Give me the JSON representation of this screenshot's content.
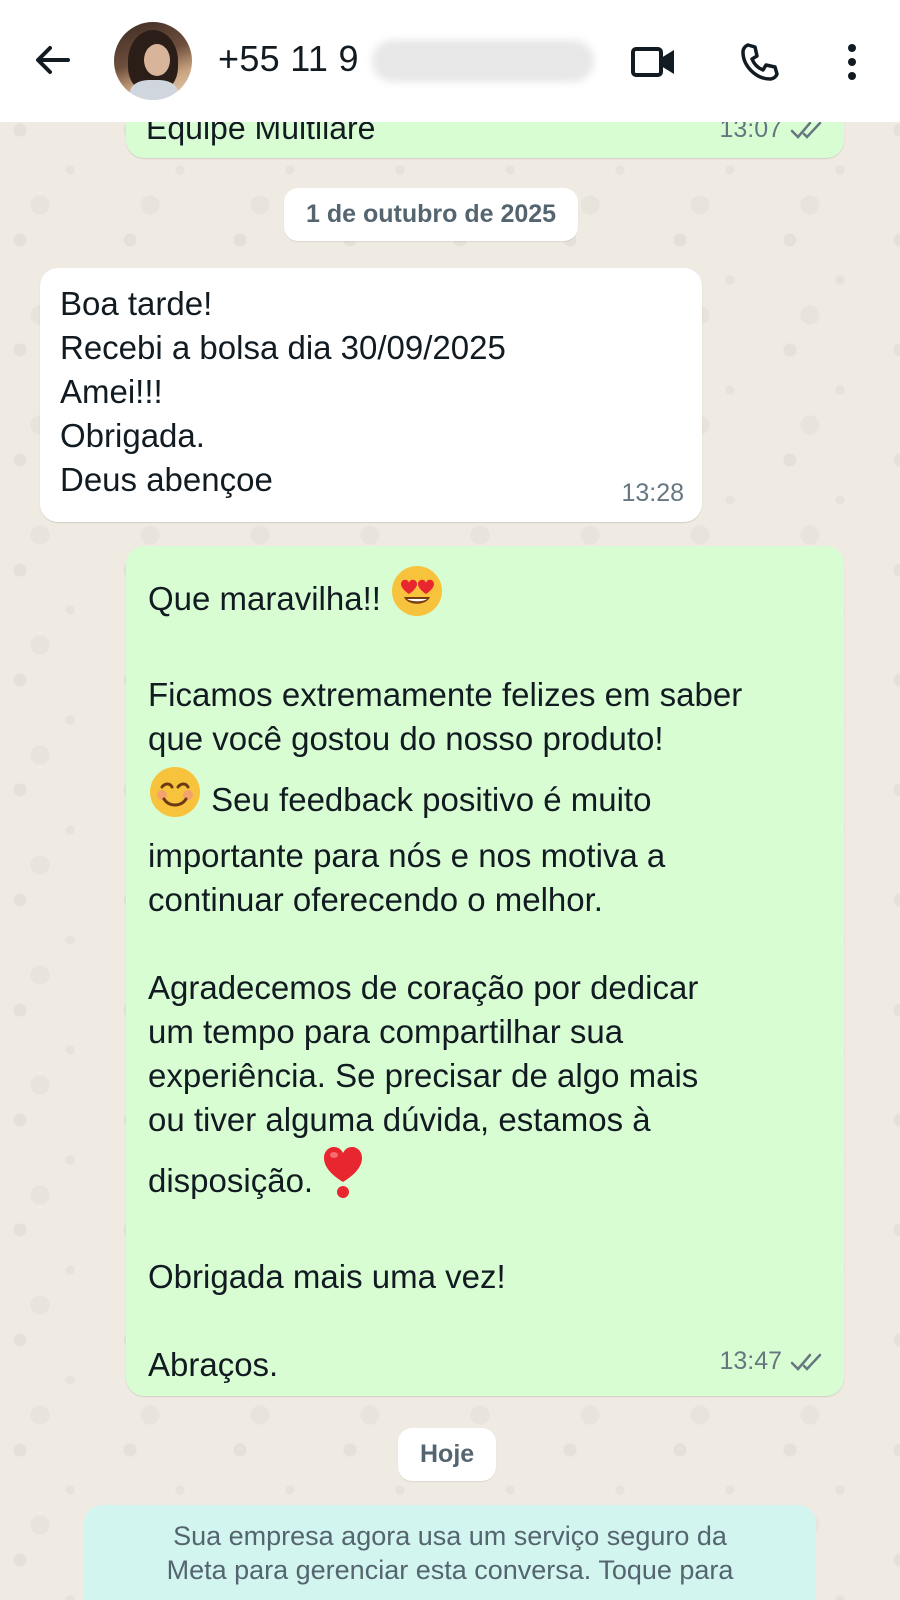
{
  "header": {
    "contact_number": "+55 11 9",
    "icons": [
      "back-arrow-icon",
      "video-call-icon",
      "phone-call-icon",
      "more-options-icon"
    ]
  },
  "messages": {
    "prev_outgoing": {
      "text": "Equipe Multilare",
      "time": "13:07"
    },
    "date_divider_1": "1 de outubro de 2025",
    "incoming_1": {
      "text": "Boa tarde!\nRecebi a bolsa dia 30/09/2025\nAmei!!!\nObrigada.\nDeus abençoe",
      "time": "13:28"
    },
    "outgoing_1": {
      "line_1": "Que maravilha!!",
      "para_2a": "Ficamos extremamente felizes em saber\nque você gostou do nosso produto!",
      "para_2b": "Seu feedback positivo é muito",
      "para_2c": "importante para nós e nos motiva a\ncontinuar oferecendo o melhor.",
      "para_3a": "Agradecemos de coração por dedicar\num tempo para compartilhar sua\nexperiência. Se precisar de algo mais\nou tiver alguma dúvida, estamos à",
      "para_3b": "disposição.",
      "para_4": "Obrigada mais uma vez!",
      "para_5": "Abraços.",
      "time": "13:47"
    },
    "date_divider_2": "Hoje",
    "system_notice": "Sua empresa agora usa um serviço seguro da\nMeta para gerenciar esta conversa. Toque para"
  },
  "colors": {
    "outgoing_bubble": "#d9fdd3",
    "incoming_bubble": "#ffffff",
    "read_ticks": "#667781",
    "system_bubble": "#d3f5ef"
  }
}
